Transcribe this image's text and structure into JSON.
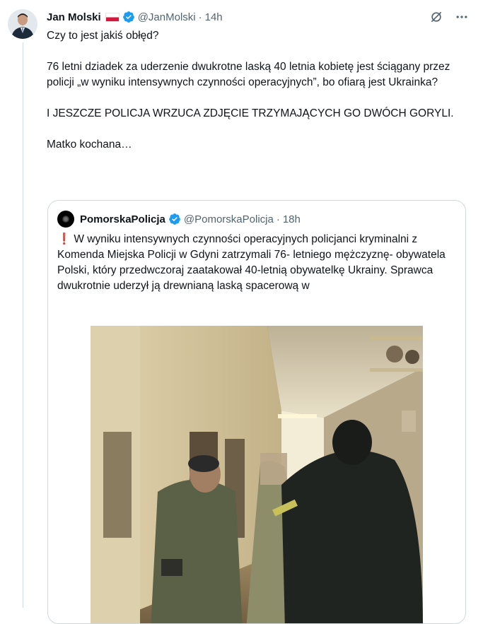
{
  "tweet": {
    "author_name": "Jan Molski",
    "handle": "@JanMolski",
    "separator": "·",
    "time": "14h",
    "icons": {
      "flag": "poland-flag-icon",
      "verified": "verified-badge-icon",
      "grok": "grok-icon",
      "more": "more-icon"
    },
    "lines": [
      "Czy to jest jakiś obłęd?",
      "76 letni dziadek za uderzenie dwukrotne laską 40 letnia kobietę jest ściągany przez policji „w wyniku intensywnych czynności operacyjnych”, bo ofiarą jest Ukrainka?",
      "I JESZCZE POLICJA WRZUCA ZDJĘCIE TRZYMAJĄCYCH GO DWÓCH GORYLI.",
      "Matko kochana…"
    ]
  },
  "quote": {
    "author_name": "PomorskaPolicja",
    "handle": "@PomorskaPolicja",
    "separator": "·",
    "time": "18h",
    "exclamation": "❗",
    "text": "W wyniku intensywnych czynności operacyjnych policjanci kryminalni z  Komenda Miejska Policji w Gdyni zatrzymali 76- letniego mężczyznę- obywatela Polski, który przedwczoraj zaatakował 40-letnią obywatelkę Ukrainy. Sprawca dwukrotnie uderzył ją drewnianą laską spacerową w"
  },
  "colors": {
    "verified": "#1d9bf0",
    "secondary_text": "#536471",
    "border": "#cfd9de",
    "flag_red": "#dc143c"
  }
}
